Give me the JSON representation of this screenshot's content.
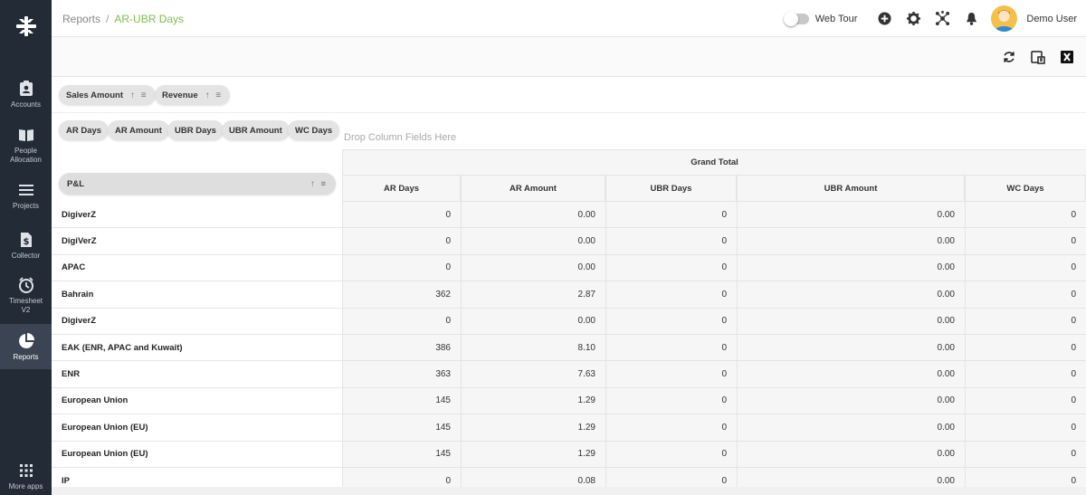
{
  "sidebar": {
    "items": [
      {
        "label": "Accounts",
        "icon": "accounts-icon"
      },
      {
        "label": "People Allocation",
        "icon": "book-icon"
      },
      {
        "label": "Projects",
        "icon": "list-icon"
      },
      {
        "label": "Collector",
        "icon": "dollar-doc-icon"
      },
      {
        "label": "Timesheet V2",
        "icon": "clock-icon"
      },
      {
        "label": "Reports",
        "icon": "pie-chart-icon",
        "active": true
      },
      {
        "label": "More apps",
        "icon": "apps-grid-icon"
      }
    ]
  },
  "breadcrumb": {
    "root": "Reports",
    "separator": "/",
    "current": "AR-UBR Days"
  },
  "topbar": {
    "web_tour": "Web Tour",
    "user": "Demo User"
  },
  "filters": {
    "row_fields": [
      {
        "label": "Sales Amount",
        "sort": "↑ ≡"
      },
      {
        "label": "Revenue",
        "sort": "↑ ≡"
      }
    ],
    "column_fields": [
      "AR Days",
      "AR Amount",
      "UBR Days",
      "UBR Amount",
      "WC Days"
    ],
    "drop_hint": "Drop Column Fields Here",
    "pl_field": {
      "label": "P&L",
      "sort": "↑ ≡"
    }
  },
  "table": {
    "group_header": "Grand Total",
    "columns": [
      "AR Days",
      "AR Amount",
      "UBR Days",
      "UBR Amount",
      "WC Days"
    ],
    "rows": [
      {
        "label": "DigiverZ",
        "values": [
          "0",
          "0.00",
          "0",
          "0.00",
          "0"
        ]
      },
      {
        "label": "DigiVerZ",
        "values": [
          "0",
          "0.00",
          "0",
          "0.00",
          "0"
        ]
      },
      {
        "label": "APAC",
        "values": [
          "0",
          "0.00",
          "0",
          "0.00",
          "0"
        ]
      },
      {
        "label": "Bahrain",
        "values": [
          "362",
          "2.87",
          "0",
          "0.00",
          "0"
        ]
      },
      {
        "label": "DigiverZ",
        "values": [
          "0",
          "0.00",
          "0",
          "0.00",
          "0"
        ]
      },
      {
        "label": "EAK (ENR, APAC and Kuwait)",
        "values": [
          "386",
          "8.10",
          "0",
          "0.00",
          "0"
        ]
      },
      {
        "label": "ENR",
        "values": [
          "363",
          "7.63",
          "0",
          "0.00",
          "0"
        ]
      },
      {
        "label": "European Union",
        "values": [
          "145",
          "1.29",
          "0",
          "0.00",
          "0"
        ]
      },
      {
        "label": "European Union (EU)",
        "values": [
          "145",
          "1.29",
          "0",
          "0.00",
          "0"
        ]
      },
      {
        "label": "European Union (EU)",
        "values": [
          "145",
          "1.29",
          "0",
          "0.00",
          "0"
        ]
      },
      {
        "label": "IP",
        "values": [
          "0",
          "0.08",
          "0",
          "0.00",
          "0"
        ]
      }
    ]
  },
  "colors": {
    "sidebar_bg": "#232b36",
    "accent_green": "#7cbf4a"
  }
}
